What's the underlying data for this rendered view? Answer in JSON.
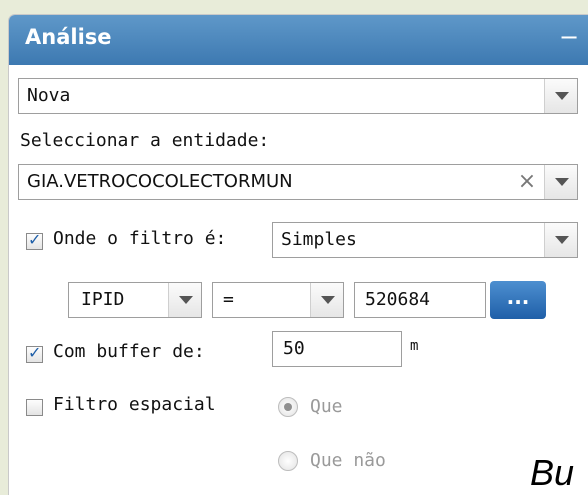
{
  "panel": {
    "title": "Análise",
    "collapse_symbol": "−"
  },
  "mode_select": {
    "value": "Nova"
  },
  "entity": {
    "label": "Seleccionar a entidade:",
    "value": "GIA.VETROCOCOLECTORMUN",
    "clear_symbol": "×"
  },
  "filter": {
    "checked": true,
    "label": "Onde o filtro é:",
    "type_value": "Simples",
    "field_value": "IPID",
    "operator_value": "=",
    "input_value": "520684",
    "more_label": "..."
  },
  "buffer": {
    "checked": true,
    "label": "Com buffer de:",
    "value": "50",
    "unit": "m"
  },
  "spatial": {
    "checked": false,
    "label": "Filtro espacial",
    "options": [
      {
        "label": "Que",
        "selected": true
      },
      {
        "label": "Que não",
        "selected": false
      }
    ]
  },
  "stray_text": "Bu",
  "colors": {
    "header": "#3d79b1",
    "button": "#1f5fa8",
    "background": "#e8ecd9"
  }
}
